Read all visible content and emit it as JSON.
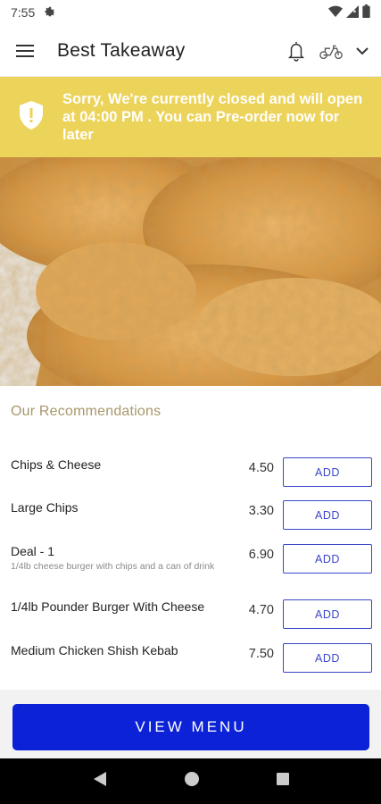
{
  "status_bar": {
    "time": "7:55",
    "icons": [
      "gear-icon",
      "wifi-icon",
      "signal-icon",
      "battery-icon"
    ]
  },
  "app_bar": {
    "title": "Best Takeaway",
    "icons": [
      "hamburger-menu-icon",
      "bell-icon",
      "scooter-icon",
      "chevron-down-icon"
    ]
  },
  "banner": {
    "message": "Sorry, We're currently closed and will open at 04:00 PM . You can Pre-order now for later",
    "icon": "shield-alert-icon",
    "background": "#ecd35a"
  },
  "hero": {
    "image": "fried-chicken-photo"
  },
  "recommendations": {
    "title": "Our Recommendations",
    "add_label": "ADD",
    "items": [
      {
        "name": "Chips & Cheese",
        "description": "",
        "price": "4.50"
      },
      {
        "name": "Large Chips",
        "description": "",
        "price": "3.30"
      },
      {
        "name": "Deal - 1",
        "description": "1/4lb cheese burger with chips and a can of drink",
        "price": "6.90"
      },
      {
        "name": "1/4lb Pounder Burger With Cheese",
        "description": "",
        "price": "4.70"
      },
      {
        "name": "Medium Chicken Shish Kebab",
        "description": "",
        "price": "7.50"
      }
    ]
  },
  "footer": {
    "view_menu_label": "VIEW MENU",
    "accent": "#0c22d6"
  },
  "nav_bar": {
    "icons": [
      "back-icon",
      "home-icon",
      "recents-icon"
    ]
  }
}
